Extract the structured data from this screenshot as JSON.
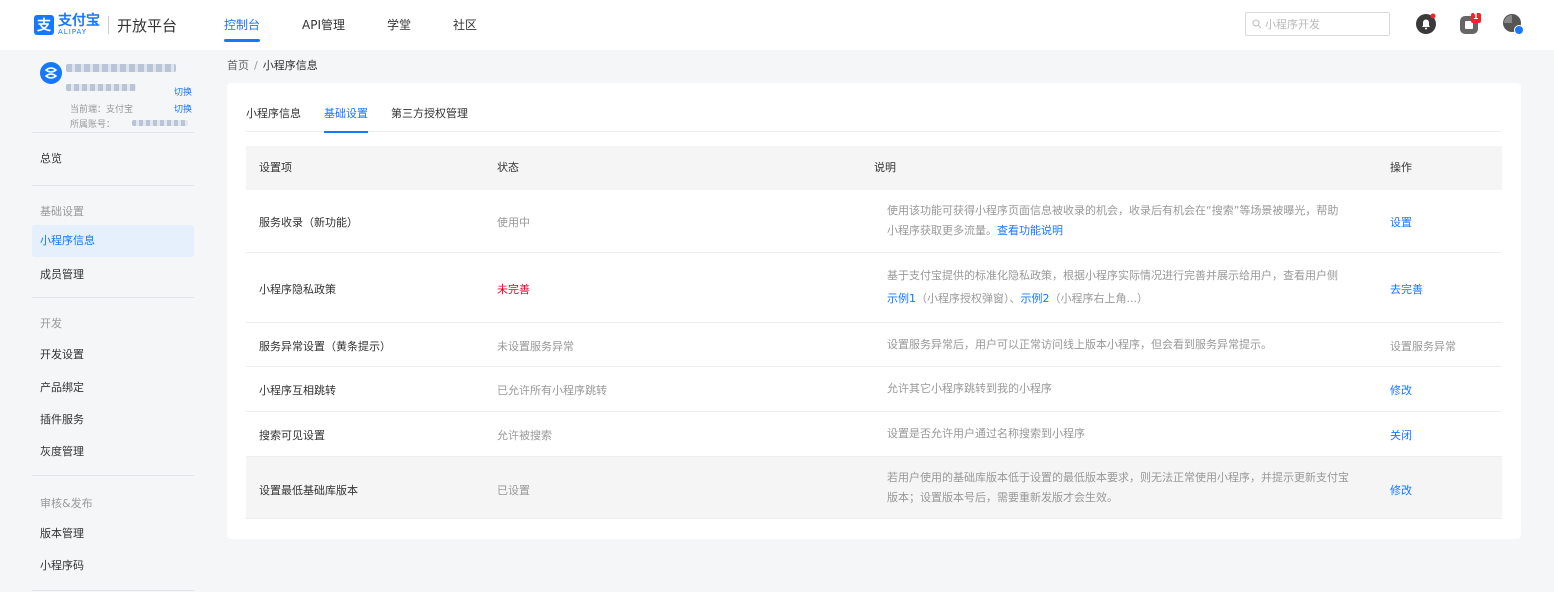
{
  "brand": {
    "cn": "支付宝",
    "en": "ALIPAY",
    "platform": "开放平台",
    "mark": "支"
  },
  "nav": [
    {
      "label": "控制台",
      "active": true
    },
    {
      "label": "API管理"
    },
    {
      "label": "学堂"
    },
    {
      "label": "社区"
    }
  ],
  "search": {
    "placeholder": "小程序开发"
  },
  "notifications": {
    "badge": "1"
  },
  "account": {
    "switch": "切换",
    "current": "当前端：支付宝",
    "owner": "所属账号："
  },
  "sidebar": {
    "overview": "总览",
    "group_basic": "基础设置",
    "mini_info": "小程序信息",
    "members": "成员管理",
    "group_dev": "开发",
    "dev_settings": "开发设置",
    "product_binding": "产品绑定",
    "plugin_service": "插件服务",
    "gray_management": "灰度管理",
    "group_review": "审核&发布",
    "version_management": "版本管理",
    "mini_code": "小程序码"
  },
  "breadcrumb": {
    "home": "首页",
    "sep": "/",
    "current": "小程序信息"
  },
  "tabs": [
    {
      "label": "小程序信息"
    },
    {
      "label": "基础设置",
      "active": true
    },
    {
      "label": "第三方授权管理"
    }
  ],
  "table": {
    "headers": {
      "item": "设置项",
      "status": "状态",
      "desc": "说明",
      "op": "操作"
    },
    "rows": [
      {
        "name": "服务收录（新功能）",
        "status": "使用中",
        "desc_line1": "使用该功能可获得小程序页面信息被收录的机会，收录后有机会在“搜索”等场景被曝光，帮助",
        "desc_line2": "小程序获取更多流量。",
        "desc_link": "查看功能说明",
        "op": "设置"
      },
      {
        "name": "小程序隐私政策",
        "status": "未完善",
        "desc_line1": "基于支付宝提供的标准化隐私政策，根据小程序实际情况进行完善并展示给用户，查看用户侧",
        "desc_link1": "示例1",
        "desc_mid1": "（小程序授权弹窗）、",
        "desc_link2": "示例2",
        "desc_mid2": "（小程序右上角...）",
        "op": "去完善"
      },
      {
        "name": "服务异常设置（黄条提示）",
        "status": "未设置服务异常",
        "desc": "设置服务异常后，用户可以正常访问线上版本小程序，但会看到服务异常提示。",
        "op": "设置服务异常"
      },
      {
        "name": "小程序互相跳转",
        "status": "已允许所有小程序跳转",
        "desc": "允许其它小程序跳转到我的小程序",
        "op": "修改"
      },
      {
        "name": "搜索可见设置",
        "status": "允许被搜索",
        "desc": "设置是否允许用户通过名称搜索到小程序",
        "op": "关闭"
      },
      {
        "name": "设置最低基础库版本",
        "status": "已设置",
        "desc_line1": "若用户使用的基础库版本低于设置的最低版本要求，则无法正常使用小程序，并提示更新支付宝",
        "desc_line2": "版本；设置版本号后，需要重新发版才会生效。",
        "op": "修改"
      }
    ]
  },
  "colors": {
    "accent": "#1677ff",
    "danger": "#e8002d",
    "muted": "#999999"
  }
}
